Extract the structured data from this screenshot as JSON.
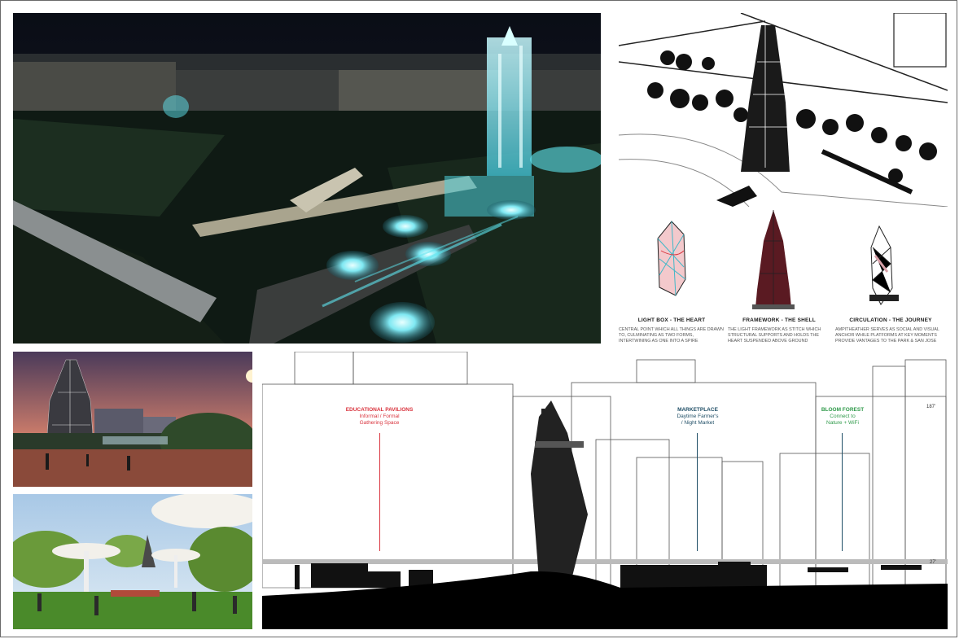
{
  "diagrams": [
    {
      "title": "LIGHT BOX - THE HEART",
      "text": "CENTRAL POINT WHICH ALL THINGS ARE DRAWN TO, CULMINATING AS TWO FORMS, INTERTWINING AS ONE INTO A SPIRE"
    },
    {
      "title": "FRAMEWORK - THE SHELL",
      "text": "THE LIGHT FRAMEWORK AS STITCH WHICH STRUCTURAL SUPPORTS AND HOLDS THE HEART SUSPENDED ABOVE GROUND"
    },
    {
      "title": "CIRCULATION - THE JOURNEY",
      "text": "AMPITHEATHER SERVES AS SOCIAL AND VISUAL ANCHOR WHILE PLATFORMS AT KEY MOMENTS PROVIDE VANTAGES TO THE PARK & SAN JOSE"
    }
  ],
  "section_labels": [
    {
      "title": "EDUCATIONAL PAVILIONS",
      "sub1": "Informal / Formal",
      "sub2": "Gathering Space",
      "color": "#d9343e"
    },
    {
      "title": "MARKETPLACE",
      "sub1": "Daytime Farmer's",
      "sub2": "/ Night Market",
      "color": "#1f4e66"
    },
    {
      "title": "BLOOM FOREST",
      "sub1": "Connect to",
      "sub2": "Nature + WiFi",
      "color": "#2f9a4a"
    }
  ],
  "dimensions": {
    "top": "187'",
    "bottom": "27'"
  },
  "colors": {
    "glow": "#5fe6f0",
    "night": "#0c1418",
    "heart": "#d8a0a8",
    "frame": "#5a1a22"
  }
}
